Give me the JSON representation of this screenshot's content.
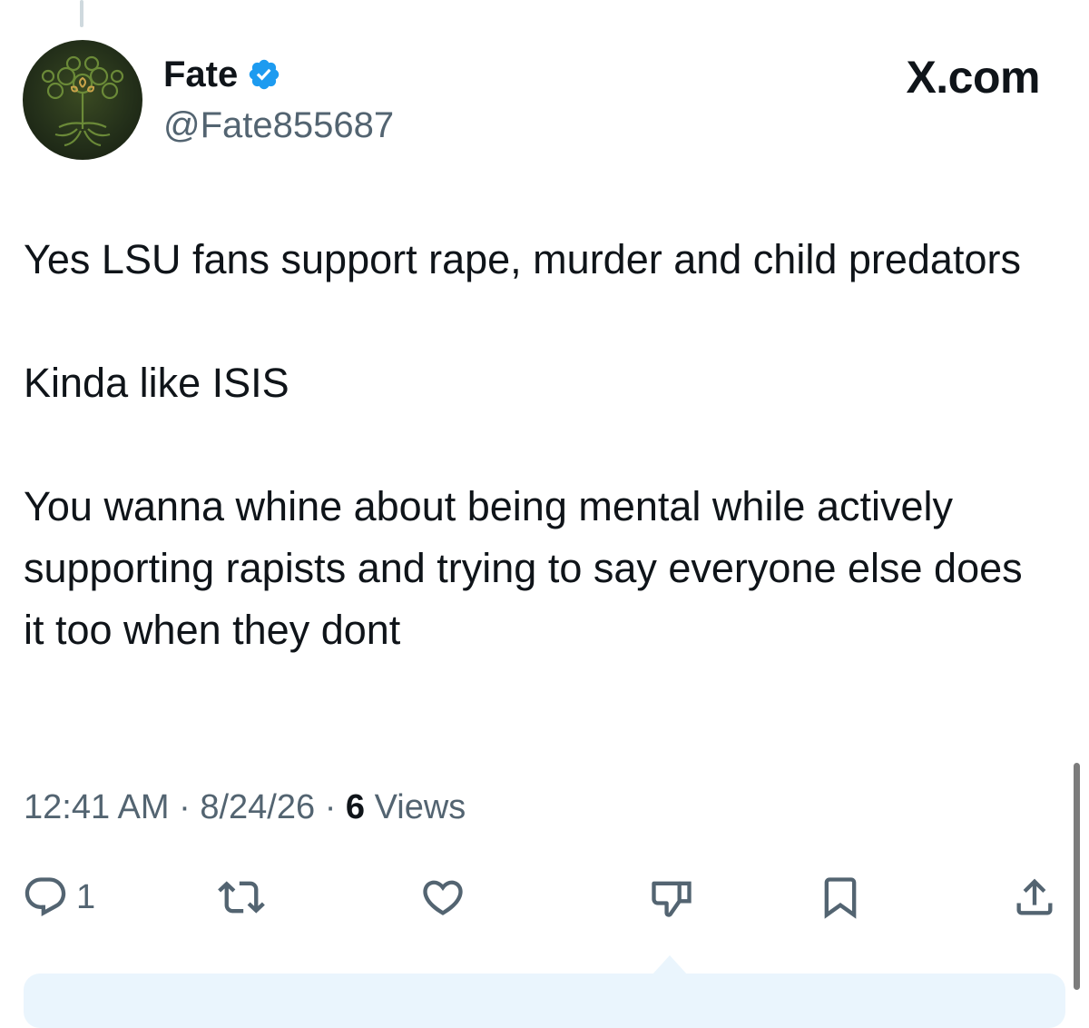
{
  "author": {
    "display_name": "Fate",
    "handle": "@Fate855687",
    "verified": true
  },
  "brand": "X.com",
  "tweet": {
    "paragraphs": [
      "Yes LSU fans support rape, murder and child predators",
      "Kinda like ISIS",
      "You wanna whine about being mental while actively supporting rapists and trying to say everyone else does it too when they dont"
    ]
  },
  "meta": {
    "time": "12:41 AM",
    "separator": "·",
    "date": "8/24/26",
    "views_count": "6",
    "views_label": "Views"
  },
  "actions": {
    "reply_count": "1"
  },
  "colors": {
    "text_primary": "#0f1419",
    "text_secondary": "#536471",
    "verified_blue": "#1d9bf0",
    "reply_box": "#eaf5fd"
  }
}
